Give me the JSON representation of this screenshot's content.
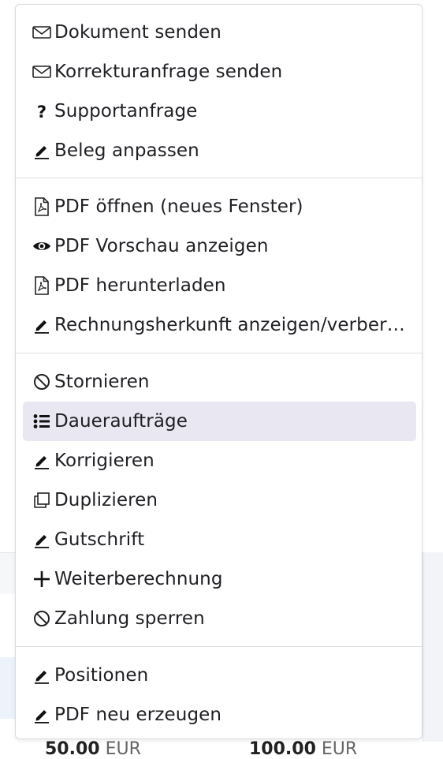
{
  "menu": {
    "items": [
      {
        "label": "Dokument senden",
        "icon": "envelope-icon"
      },
      {
        "label": "Korrekturanfrage senden",
        "icon": "envelope-icon"
      },
      {
        "label": "Supportanfrage",
        "icon": "question-icon"
      },
      {
        "label": "Beleg anpassen",
        "icon": "pencil-icon"
      },
      {
        "label": "PDF öffnen (neues Fenster)",
        "icon": "pdf-file-icon"
      },
      {
        "label": "PDF Vorschau anzeigen",
        "icon": "eye-icon"
      },
      {
        "label": "PDF herunterladen",
        "icon": "pdf-file-icon"
      },
      {
        "label": "Rechnungsherkunft anzeigen/verber…",
        "icon": "pencil-icon"
      },
      {
        "label": "Stornieren",
        "icon": "ban-icon"
      },
      {
        "label": "Daueraufträge",
        "icon": "list-icon",
        "active": true
      },
      {
        "label": "Korrigieren",
        "icon": "pencil-icon"
      },
      {
        "label": "Duplizieren",
        "icon": "copy-icon"
      },
      {
        "label": "Gutschrift",
        "icon": "pencil-icon"
      },
      {
        "label": "Weiterberechnung",
        "icon": "plus-icon"
      },
      {
        "label": "Zahlung sperren",
        "icon": "ban-icon"
      },
      {
        "label": "Positionen",
        "icon": "pencil-icon"
      },
      {
        "label": "PDF neu erzeugen",
        "icon": "pencil-icon"
      }
    ]
  },
  "background": {
    "amount_left": "50.00",
    "amount_right": "100.00",
    "currency": "EUR"
  }
}
